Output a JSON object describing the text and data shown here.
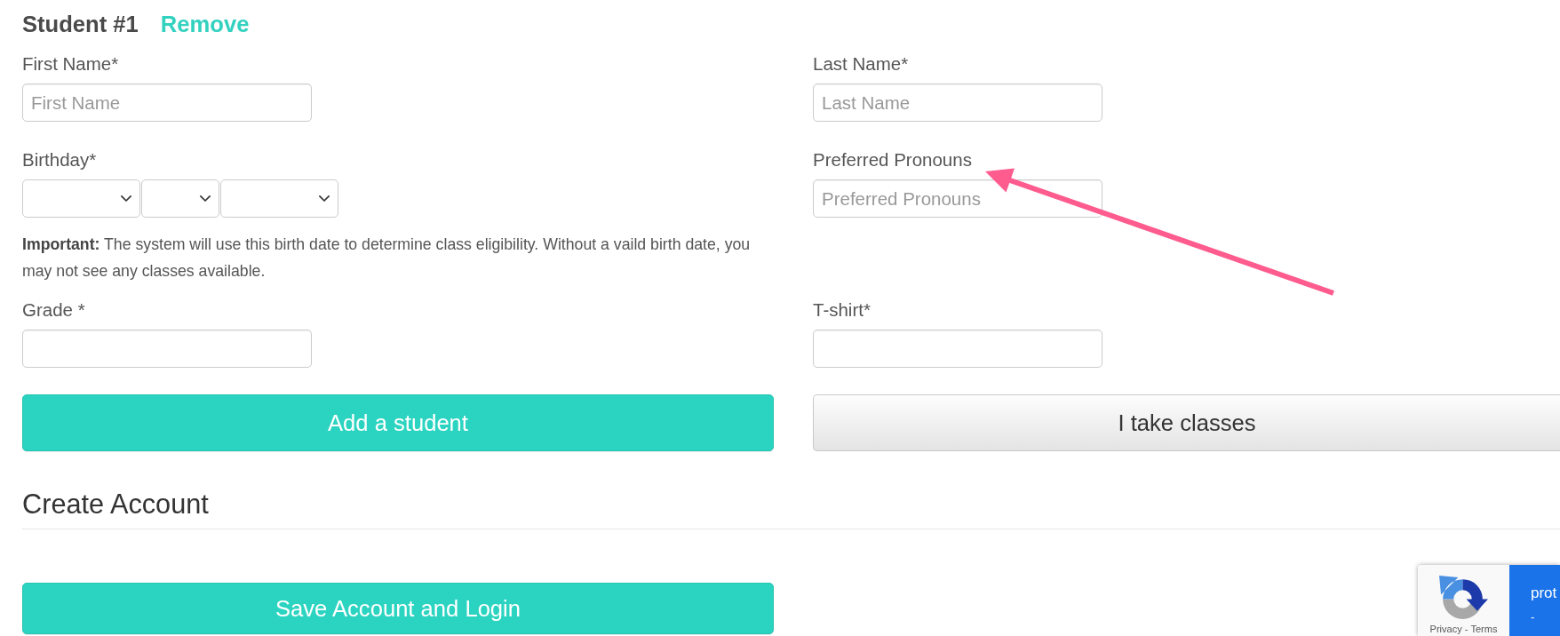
{
  "student_section": {
    "heading": "Student #1",
    "remove_link": "Remove",
    "fields": [
      {
        "kind": "text",
        "label": "First Name*",
        "placeholder": "First Name"
      },
      {
        "kind": "text",
        "label": "Last Name*",
        "placeholder": "Last Name"
      },
      {
        "kind": "date",
        "label": "Birthday*",
        "dropdowns": [
          {
            "kind": "dropdown"
          },
          {
            "kind": "dropdown"
          },
          {
            "kind": "dropdown"
          }
        ],
        "note": "**Important:** The system will use this birth date to determine class eligibility. Without a vaild birth date, you may not see any classes available."
      },
      {
        "kind": "text",
        "label": "Preferred Pronouns",
        "placeholder": "Preferred Pronouns"
      },
      {
        "kind": "text",
        "label": "Grade *"
      },
      {
        "kind": "text",
        "label": "T-shirt*"
      }
    ],
    "buttons": [
      {
        "kind": "primary",
        "label": "Add a student"
      },
      {
        "kind": "secondary",
        "label": "I take classes"
      }
    ]
  },
  "account_section": {
    "heading": "Create Account",
    "buttons": [
      {
        "kind": "primary",
        "label": "Save Account and Login"
      }
    ]
  },
  "annotation": {
    "kind": "arrow"
  },
  "captcha_badge": {
    "label": "prot",
    "sublabel": "-",
    "links": [
      "Privacy",
      "Terms"
    ],
    "separator": "-"
  }
}
